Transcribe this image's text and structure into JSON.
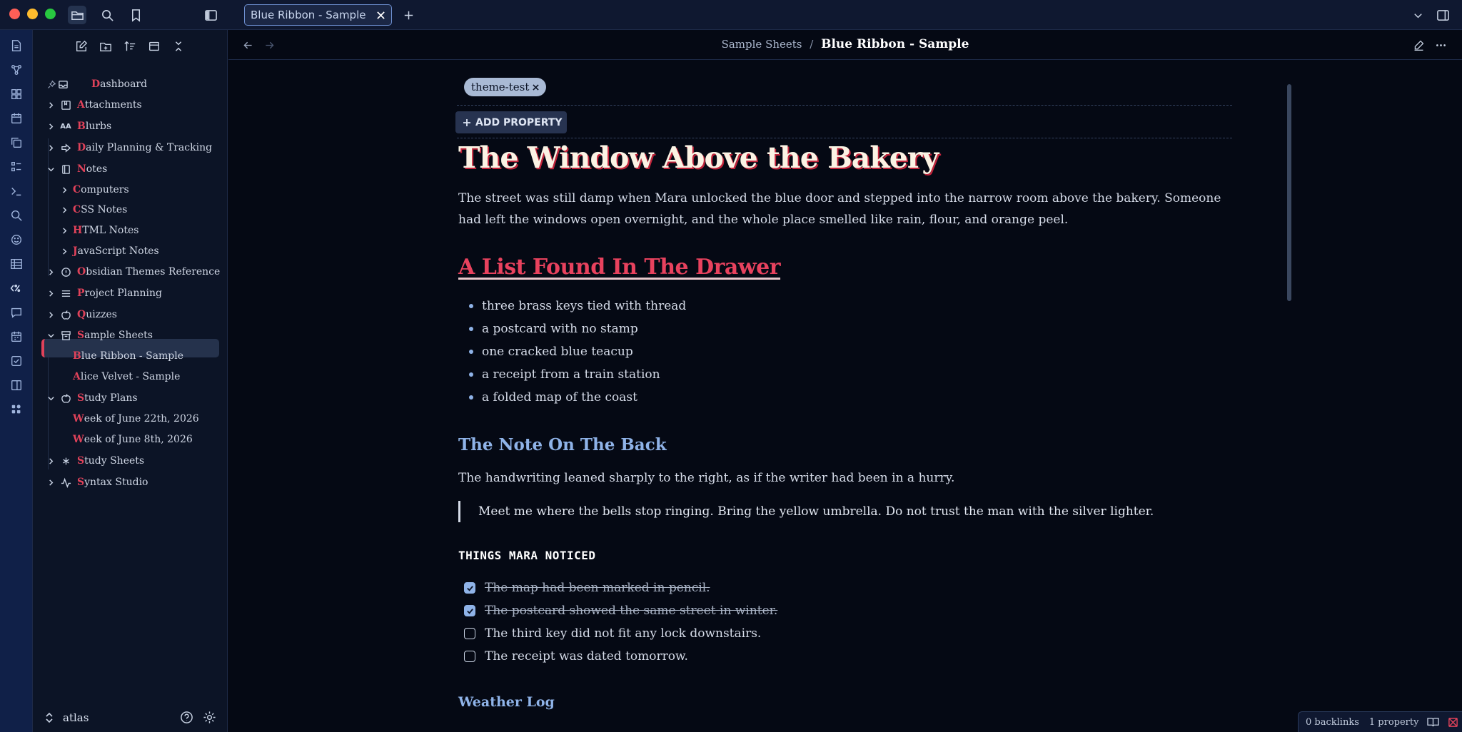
{
  "window": {
    "tab_title": "Blue Ribbon - Sample"
  },
  "header": {
    "breadcrumb_parent": "Sample Sheets",
    "breadcrumb_separator": "/",
    "breadcrumb_current": "Blue Ribbon - Sample"
  },
  "sidebar": {
    "items": [
      {
        "first": "D",
        "rest": "ashboard"
      },
      {
        "first": "A",
        "rest": "ttachments"
      },
      {
        "first": "B",
        "rest": "lurbs"
      },
      {
        "first": "D",
        "rest": "aily Planning & Tracking"
      },
      {
        "first": "N",
        "rest": "otes"
      },
      {
        "first": "C",
        "rest": "omputers"
      },
      {
        "first": "C",
        "rest": "SS Notes"
      },
      {
        "first": "H",
        "rest": "TML Notes"
      },
      {
        "first": "J",
        "rest": "avaScript Notes"
      },
      {
        "first": "O",
        "rest": "bsidian Themes Reference"
      },
      {
        "first": "P",
        "rest": "roject Planning"
      },
      {
        "first": "Q",
        "rest": "uizzes"
      },
      {
        "first": "S",
        "rest": "ample Sheets"
      },
      {
        "first": "B",
        "rest": "lue Ribbon - Sample"
      },
      {
        "first": "A",
        "rest": "lice Velvet - Sample"
      },
      {
        "first": "S",
        "rest": "tudy Plans"
      },
      {
        "first": "W",
        "rest": "eek of June 22th, 2026"
      },
      {
        "first": "W",
        "rest": "eek of June 8th, 2026"
      },
      {
        "first": "S",
        "rest": "tudy Sheets"
      },
      {
        "first": "S",
        "rest": "yntax Studio"
      }
    ],
    "blurbs_icon_text": "AA",
    "vault_name": "atlas"
  },
  "properties": {
    "tag": "theme-test",
    "add_property_label": "ADD PROPERTY"
  },
  "note": {
    "title": "The Window Above the Bakery",
    "intro": "The street was still damp when Mara unlocked the blue door and stepped into the narrow room above the bakery. Someone had left the windows open overnight, and the whole place smelled like rain, flour, and orange peel.",
    "h2": "A List Found In The Drawer",
    "list": [
      "three brass keys tied with thread",
      "a postcard with no stamp",
      "one cracked blue teacup",
      "a receipt from a train station",
      "a folded map of the coast"
    ],
    "h3": "The Note On The Back",
    "para2": "The handwriting leaned sharply to the right, as if the writer had been in a hurry.",
    "quote": "Meet me where the bells stop ringing. Bring the yellow umbrella. Do not trust the man with the silver lighter.",
    "h4": "THINGS MARA NOTICED",
    "tasks": [
      {
        "text": "The map had been marked in pencil.",
        "done": true
      },
      {
        "text": "The postcard showed the same street in winter.",
        "done": true
      },
      {
        "text": "The third key did not fit any lock downstairs.",
        "done": false
      },
      {
        "text": "The receipt was dated tomorrow.",
        "done": false
      }
    ],
    "h5": "Weather Log"
  },
  "status": {
    "backlinks": "0 backlinks",
    "properties": "1 property"
  },
  "colors": {
    "accent_red": "#e0425a",
    "accent_blue": "#8fb3e8",
    "background": "#050914"
  }
}
